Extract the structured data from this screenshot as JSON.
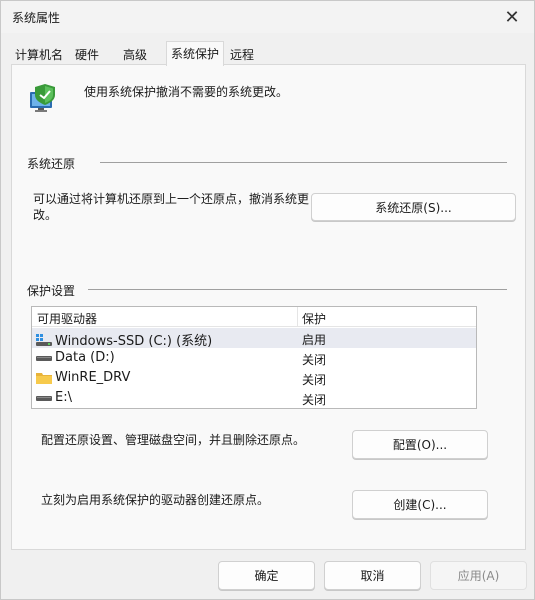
{
  "window": {
    "title": "系统属性",
    "close_glyph": "✕"
  },
  "tabs": [
    {
      "label": "计算机名",
      "active": false
    },
    {
      "label": "硬件",
      "active": false
    },
    {
      "label": "高级",
      "active": false
    },
    {
      "label": "系统保护",
      "active": true
    },
    {
      "label": "远程",
      "active": false
    }
  ],
  "intro": {
    "icon": "system-protection-shield-icon",
    "text": "使用系统保护撤消不需要的系统更改。"
  },
  "restore": {
    "group_label": "系统还原",
    "description": "可以通过将计算机还原到上一个还原点，撤消系统更改。",
    "button_label": "系统还原(S)..."
  },
  "protection": {
    "group_label": "保护设置",
    "columns": {
      "drive": "可用驱动器",
      "status": "保护"
    },
    "drives": [
      {
        "icon": "system-drive-icon",
        "name": "Windows-SSD (C:) (系统)",
        "status": "启用",
        "selected": true
      },
      {
        "icon": "drive-icon",
        "name": "Data (D:)",
        "status": "关闭",
        "selected": false
      },
      {
        "icon": "folder-icon",
        "name": "WinRE_DRV",
        "status": "关闭",
        "selected": false
      },
      {
        "icon": "drive-icon",
        "name": "E:\\",
        "status": "关闭",
        "selected": false
      }
    ],
    "configure_text": "配置还原设置、管理磁盘空间，并且删除还原点。",
    "configure_button": "配置(O)...",
    "create_text": "立刻为启用系统保护的驱动器创建还原点。",
    "create_button": "创建(C)..."
  },
  "footer": {
    "ok": "确定",
    "cancel": "取消",
    "apply": "应用(A)"
  }
}
